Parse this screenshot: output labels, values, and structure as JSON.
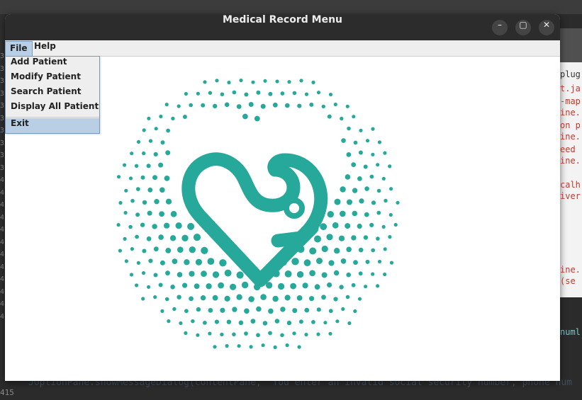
{
  "window": {
    "title": "Medical Record Menu"
  },
  "controls": {
    "minimize": "–",
    "maximize": "▢",
    "close": "✕"
  },
  "menubar": {
    "file": "File",
    "help": "Help"
  },
  "file_menu": {
    "items": [
      "Add Patient",
      "Modify Patient",
      "Search Patient",
      "Display All Patient"
    ],
    "exit": "Exit"
  },
  "logo": {
    "icon": "heart-stethoscope-icon",
    "color": "#26a99a"
  },
  "ide": {
    "gutter": [
      "3",
      "3",
      "3",
      "3",
      "3",
      "3",
      "3",
      "3",
      "3",
      "3",
      "4",
      "4",
      "4",
      "4",
      "4",
      "4",
      "4",
      "4",
      "4",
      "4",
      "4",
      "4"
    ],
    "gutter_last": "415",
    "right_lines": [
      {
        "text": "plug",
        "color": "#333333"
      },
      {
        "text": "t.ja",
        "color": "#c0392b"
      },
      {
        "text": "-map",
        "color": "#c0392b"
      },
      {
        "text": "ine.",
        "color": "#c0392b"
      },
      {
        "text": "on p",
        "color": "#c0392b"
      },
      {
        "text": "ine.",
        "color": "#c0392b"
      },
      {
        "text": "eed",
        "color": "#c0392b"
      },
      {
        "text": "ine.",
        "color": "#c0392b"
      },
      {
        "text": "calh",
        "color": "#c0392b"
      },
      {
        "text": "iver",
        "color": "#c0392b"
      },
      {
        "text": "ine.",
        "color": "#c0392b"
      },
      {
        "text": " (se",
        "color": "#c0392b"
      }
    ],
    "console_text": "numl",
    "bottom_code": "JOptionPane.showMessageDialog(contentPane, \"You enter an invalid social security number, phone num"
  }
}
